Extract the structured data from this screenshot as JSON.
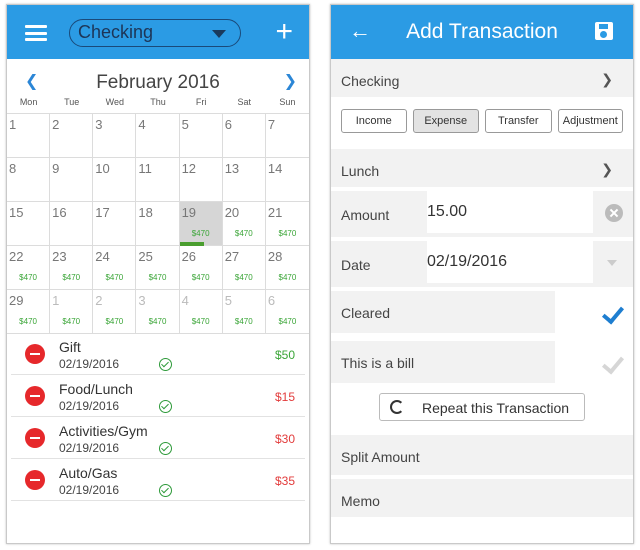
{
  "calendar_screen": {
    "header": {
      "account": "Checking",
      "add_icon": "plus-icon",
      "menu_icon": "hamburger-icon"
    },
    "month_title": "February 2016",
    "weekdays": [
      "Mon",
      "Tue",
      "Wed",
      "Thu",
      "Fri",
      "Sat",
      "Sun"
    ],
    "days": [
      {
        "n": "1",
        "amt": ""
      },
      {
        "n": "2",
        "amt": ""
      },
      {
        "n": "3",
        "amt": ""
      },
      {
        "n": "4",
        "amt": ""
      },
      {
        "n": "5",
        "amt": ""
      },
      {
        "n": "6",
        "amt": ""
      },
      {
        "n": "7",
        "amt": ""
      },
      {
        "n": "8",
        "amt": ""
      },
      {
        "n": "9",
        "amt": ""
      },
      {
        "n": "10",
        "amt": ""
      },
      {
        "n": "11",
        "amt": ""
      },
      {
        "n": "12",
        "amt": ""
      },
      {
        "n": "13",
        "amt": ""
      },
      {
        "n": "14",
        "amt": ""
      },
      {
        "n": "15",
        "amt": ""
      },
      {
        "n": "16",
        "amt": ""
      },
      {
        "n": "17",
        "amt": ""
      },
      {
        "n": "18",
        "amt": ""
      },
      {
        "n": "19",
        "amt": "$470"
      },
      {
        "n": "20",
        "amt": "$470"
      },
      {
        "n": "21",
        "amt": "$470"
      },
      {
        "n": "22",
        "amt": "$470"
      },
      {
        "n": "23",
        "amt": "$470"
      },
      {
        "n": "24",
        "amt": "$470"
      },
      {
        "n": "25",
        "amt": "$470"
      },
      {
        "n": "26",
        "amt": "$470"
      },
      {
        "n": "27",
        "amt": "$470"
      },
      {
        "n": "28",
        "amt": "$470"
      },
      {
        "n": "29",
        "amt": "$470"
      },
      {
        "n": "1",
        "amt": "$470"
      },
      {
        "n": "2",
        "amt": "$470"
      },
      {
        "n": "3",
        "amt": "$470"
      },
      {
        "n": "4",
        "amt": "$470"
      },
      {
        "n": "5",
        "amt": "$470"
      },
      {
        "n": "6",
        "amt": "$470"
      }
    ],
    "transactions": [
      {
        "name": "Gift",
        "date": "02/19/2016",
        "amount": "$50"
      },
      {
        "name": "Food/Lunch",
        "date": "02/19/2016",
        "amount": "$15"
      },
      {
        "name": "Activities/Gym",
        "date": "02/19/2016",
        "amount": "$30"
      },
      {
        "name": "Auto/Gas",
        "date": "02/19/2016",
        "amount": "$35"
      }
    ],
    "colors": {
      "accent": "#2b9be4",
      "income": "#3aa537",
      "expense": "#e23b3b"
    }
  },
  "add_screen": {
    "title": "Add Transaction",
    "account": "Checking",
    "types": [
      "Income",
      "Expense",
      "Transfer",
      "Adjustment"
    ],
    "selected_type": "Expense",
    "category": "Lunch",
    "amount_label": "Amount",
    "amount_value": "15.00",
    "date_label": "Date",
    "date_value": "02/19/2016",
    "cleared_label": "Cleared",
    "bill_label": "This is a bill",
    "repeat_label": "Repeat this Transaction",
    "split_label": "Split Amount",
    "memo_label": "Memo"
  }
}
